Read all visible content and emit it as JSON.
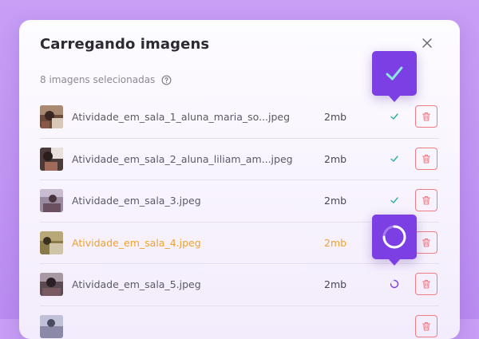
{
  "dialog": {
    "title": "Carregando imagens",
    "subtitle": "8 imagens selecionadas"
  },
  "icons": {
    "close": "close-icon",
    "help": "help-circle-icon",
    "complete": "check-icon",
    "loading": "spinner-icon",
    "delete": "trash-icon"
  },
  "colors": {
    "accent": "#7b3fe4",
    "complete": "#2ab0a4",
    "active_text": "#f0a22a",
    "delete": "#f07c84"
  },
  "files": [
    {
      "name": "Atividade_em_sala_1_aluna_maria_so...jpeg",
      "size": "2mb",
      "status": "complete"
    },
    {
      "name": "Atividade_em_sala_2_aluna_liliam_am...jpeg",
      "size": "2mb",
      "status": "complete"
    },
    {
      "name": "Atividade_em_sala_3.jpeg",
      "size": "2mb",
      "status": "complete"
    },
    {
      "name": "Atividade_em_sala_4.jpeg",
      "size": "2mb",
      "status": "uploading"
    },
    {
      "name": "Atividade_em_sala_5.jpeg",
      "size": "2mb",
      "status": "loading"
    },
    {
      "name": "",
      "size": "",
      "status": ""
    }
  ]
}
